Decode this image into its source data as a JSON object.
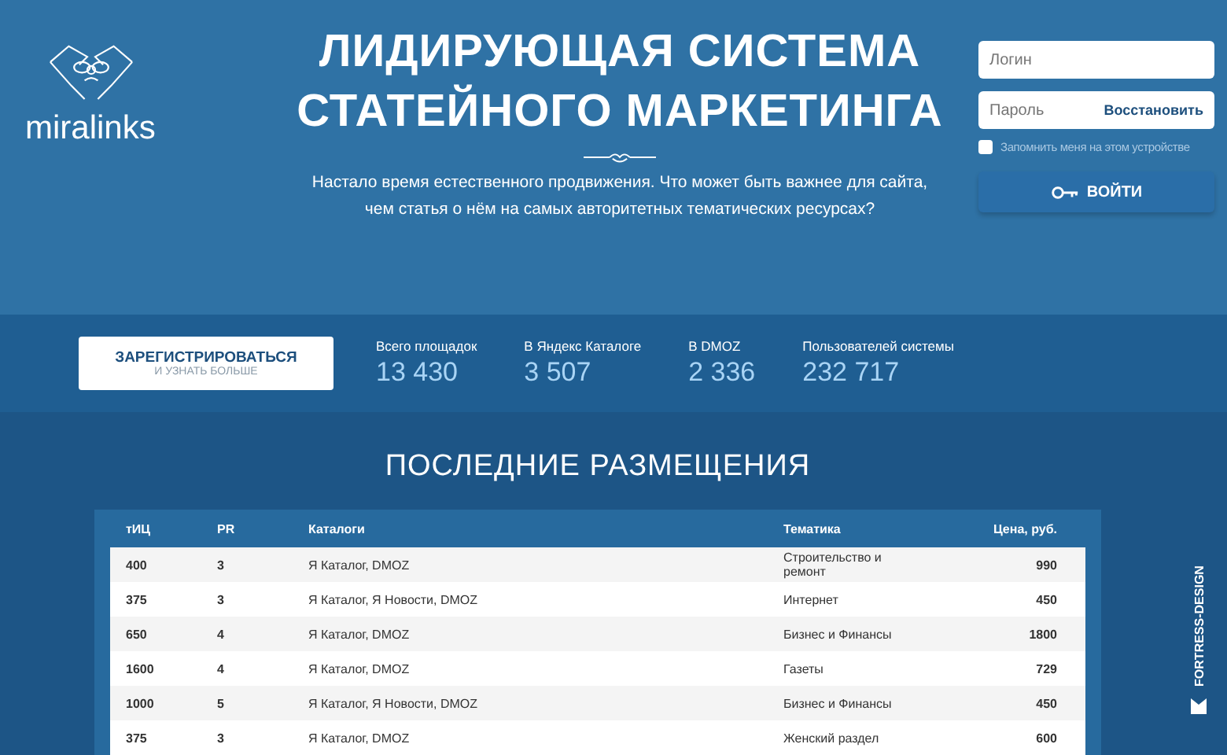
{
  "logo": {
    "text": "miralinks"
  },
  "hero": {
    "title_lines": [
      "ЛИДИРУЮЩАЯ СИСТЕМА",
      "СТАТЕЙНОГО МАРКЕТИНГА"
    ],
    "description": "Настало время естественного продвижения. Что может быть важнее для сайта, чем статья о нём на самых авторитетных тематических ресурсах?"
  },
  "login": {
    "login_placeholder": "Логин",
    "password_placeholder": "Пароль",
    "restore_link": "Восстановить",
    "remember": {
      "label": "Запомнить меня на этом устройстве",
      "checked": false
    },
    "submit": "ВОЙТИ"
  },
  "register_button": {
    "title": "ЗАРЕГИСТРИРОВАТЬСЯ",
    "subtitle": "И УЗНАТЬ БОЛЬШЕ"
  },
  "stats": [
    {
      "label": "Всего площадок",
      "value": "13 430"
    },
    {
      "label": "В Яндекс Каталоге",
      "value": "3 507"
    },
    {
      "label": "В DMOZ",
      "value": "2 336"
    },
    {
      "label": "Пользователей системы",
      "value": "232 717"
    }
  ],
  "section_title": "ПОСЛЕДНИЕ РАЗМЕЩЕНИЯ",
  "table": {
    "columns": [
      "тИЦ",
      "PR",
      "Каталоги",
      "Тематика",
      "Цена, руб."
    ],
    "rows": [
      [
        "400",
        "3",
        "Я Каталог, DMOZ",
        "Строительство и ремонт",
        "990"
      ],
      [
        "375",
        "3",
        "Я Каталог, Я Новости, DMOZ",
        "Интернет",
        "450"
      ],
      [
        "650",
        "4",
        "Я Каталог, DMOZ",
        "Бизнес и Финансы",
        "1800"
      ],
      [
        "1600",
        "4",
        "Я Каталог, DMOZ",
        "Газеты",
        "729"
      ],
      [
        "1000",
        "5",
        "Я Каталог, Я Новости, DMOZ",
        "Бизнес и Финансы",
        "450"
      ],
      [
        "375",
        "3",
        "Я Каталог, DMOZ",
        "Женский раздел",
        "600"
      ]
    ]
  },
  "side_badge": {
    "text": "FORTRESS-DESIGN"
  }
}
